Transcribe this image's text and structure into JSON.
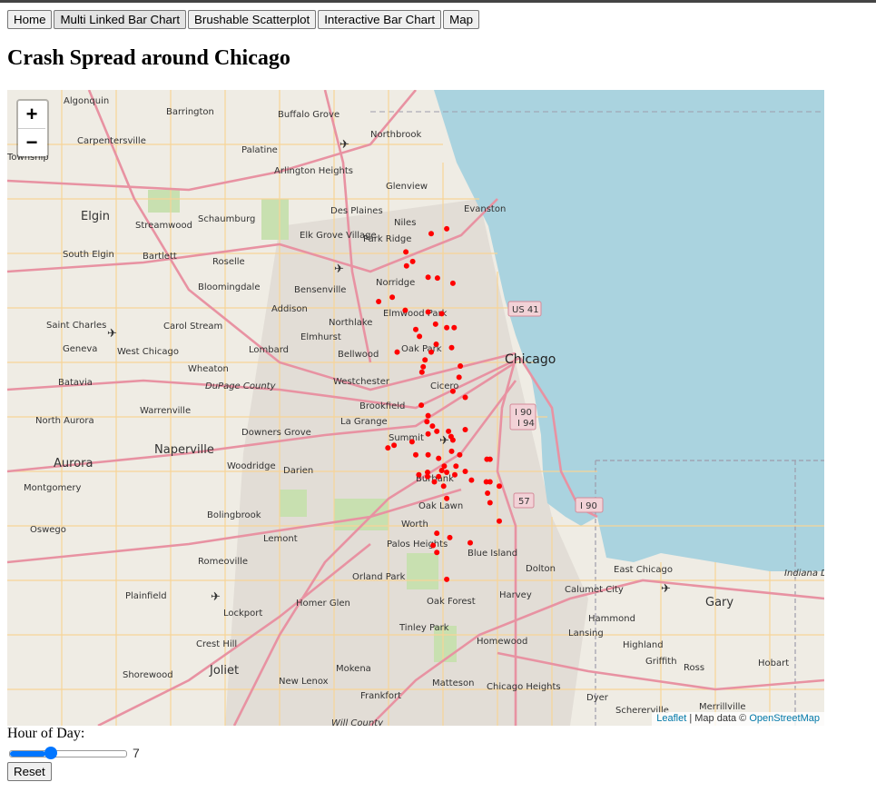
{
  "nav": {
    "buttons": [
      "Home",
      "Multi Linked Bar Chart",
      "Brushable Scatterplot",
      "Interactive Bar Chart",
      "Map"
    ]
  },
  "page": {
    "title": "Crash Spread around Chicago"
  },
  "map": {
    "zoom_in": "+",
    "zoom_out": "−",
    "attribution": {
      "leaflet": "Leaflet",
      "sep": " | Map data © ",
      "osm": "OpenStreetMap"
    },
    "place_labels": [
      "Algonquin",
      "Barrington",
      "Buffalo Grove",
      "Northbrook",
      "Carpentersville",
      "Township",
      "Palatine",
      "Arlington Heights",
      "Glenview",
      "Evanston",
      "Elgin",
      "Streamwood",
      "Schaumburg",
      "Des Plaines",
      "Niles",
      "Elk Grove Village",
      "Park Ridge",
      "South Elgin",
      "Bartlett",
      "Roselle",
      "Norridge",
      "Bloomingdale",
      "Bensenville",
      "Addison",
      "Elmwood Park",
      "Saint Charles",
      "Carol Stream",
      "Northlake",
      "Elmhurst",
      "Geneva",
      "West Chicago",
      "Lombard",
      "Bellwood",
      "Oak Park",
      "Chicago",
      "Wheaton",
      "Batavia",
      "Westchester",
      "Cicero",
      "DuPage County",
      "Brookfield",
      "Warrenville",
      "North Aurora",
      "La Grange",
      "Downers Grove",
      "Summit",
      "Naperville",
      "Aurora",
      "Woodridge",
      "Darien",
      "Burbank",
      "Montgomery",
      "Oak Lawn",
      "Bolingbrook",
      "Oswego",
      "Worth",
      "Lemont",
      "Palos Heights",
      "Blue Island",
      "Romeoville",
      "Dolton",
      "East Chicago",
      "Orland Park",
      "Plainfield",
      "Harvey",
      "Calumet City",
      "Homer Glen",
      "Oak Forest",
      "Gary",
      "Lockport",
      "Hammond",
      "Tinley Park",
      "Indiana Dunes National Park",
      "Crest Hill",
      "Lansing",
      "Homewood",
      "Highland",
      "Griffith",
      "Shorewood",
      "Joliet",
      "Mokena",
      "New Lenox",
      "Matteson",
      "Chicago Heights",
      "Ross",
      "Hobart",
      "Frankfort",
      "Dyer",
      "Schererville",
      "Merrillville",
      "Will County"
    ],
    "route_shields": [
      "US 41",
      "I 90",
      "I 94",
      "57",
      "I 90"
    ],
    "crash_color": "#ff0000",
    "crashes": [
      [
        42.0555,
        -87.67
      ],
      [
        42.05,
        -87.695
      ],
      [
        42.029,
        -87.736
      ],
      [
        42.018,
        -87.725
      ],
      [
        42.013,
        -87.735
      ],
      [
        42.0,
        -87.7
      ],
      [
        41.999,
        -87.685
      ],
      [
        41.993,
        -87.66
      ],
      [
        41.977,
        -87.758
      ],
      [
        41.972,
        -87.78
      ],
      [
        41.962,
        -87.737
      ],
      [
        41.96,
        -87.7
      ],
      [
        41.958,
        -87.678
      ],
      [
        41.946,
        -87.688
      ],
      [
        41.942,
        -87.67
      ],
      [
        41.942,
        -87.658
      ],
      [
        41.94,
        -87.72
      ],
      [
        41.932,
        -87.714
      ],
      [
        41.923,
        -87.687
      ],
      [
        41.919,
        -87.662
      ],
      [
        41.914,
        -87.75
      ],
      [
        41.914,
        -87.695
      ],
      [
        41.905,
        -87.705
      ],
      [
        41.898,
        -87.648
      ],
      [
        41.897,
        -87.708
      ],
      [
        41.891,
        -87.71
      ],
      [
        41.885,
        -87.65
      ],
      [
        41.869,
        -87.66
      ],
      [
        41.862,
        -87.64
      ],
      [
        41.853,
        -87.711
      ],
      [
        41.841,
        -87.7
      ],
      [
        41.834,
        -87.702
      ],
      [
        41.829,
        -87.693
      ],
      [
        41.825,
        -87.64
      ],
      [
        41.823,
        -87.686
      ],
      [
        41.823,
        -87.667
      ],
      [
        41.82,
        -87.7
      ],
      [
        41.817,
        -87.663
      ],
      [
        41.813,
        -87.66
      ],
      [
        41.811,
        -87.726
      ],
      [
        41.807,
        -87.755
      ],
      [
        41.804,
        -87.765
      ],
      [
        41.8,
        -87.662
      ],
      [
        41.796,
        -87.649
      ],
      [
        41.796,
        -87.7
      ],
      [
        41.796,
        -87.72
      ],
      [
        41.792,
        -87.683
      ],
      [
        41.791,
        -87.605
      ],
      [
        41.791,
        -87.6
      ],
      [
        41.783,
        -87.674
      ],
      [
        41.783,
        -87.655
      ],
      [
        41.778,
        -87.678
      ],
      [
        41.777,
        -87.64
      ],
      [
        41.776,
        -87.701
      ],
      [
        41.776,
        -87.67
      ],
      [
        41.773,
        -87.715
      ],
      [
        41.773,
        -87.657
      ],
      [
        41.771,
        -87.701
      ],
      [
        41.771,
        -87.683
      ],
      [
        41.767,
        -87.63
      ],
      [
        41.765,
        -87.6
      ],
      [
        41.765,
        -87.606
      ],
      [
        41.765,
        -87.69
      ],
      [
        41.76,
        -87.585
      ],
      [
        41.76,
        -87.675
      ],
      [
        41.752,
        -87.604
      ],
      [
        41.746,
        -87.67
      ],
      [
        41.741,
        -87.6
      ],
      [
        41.72,
        -87.585
      ],
      [
        41.706,
        -87.686
      ],
      [
        41.701,
        -87.665
      ],
      [
        41.695,
        -87.632
      ],
      [
        41.692,
        -87.692
      ],
      [
        41.684,
        -87.686
      ],
      [
        41.653,
        -87.67
      ]
    ]
  },
  "controls": {
    "hour_label": "Hour of Day:",
    "hour_value": "7",
    "hour_min": 0,
    "hour_max": 23,
    "reset_label": "Reset"
  }
}
